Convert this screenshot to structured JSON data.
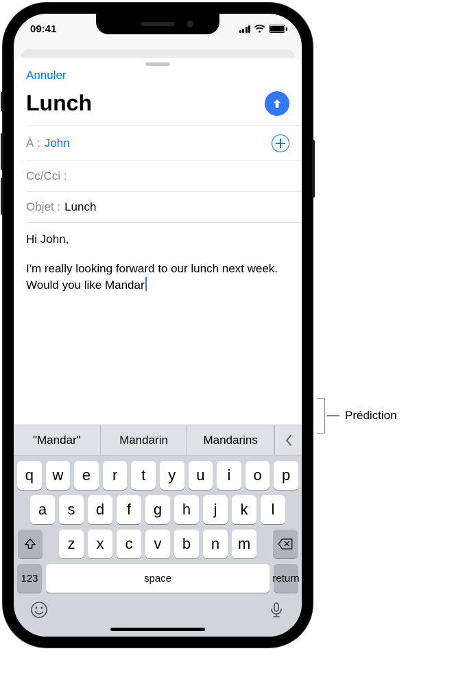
{
  "statusbar": {
    "time": "09:41"
  },
  "compose": {
    "cancel": "Annuler",
    "title": "Lunch",
    "to_label": "À :",
    "to_value": "John",
    "cc_label": "Cc/Cci :",
    "subject_label": "Objet :",
    "subject_value": "Lunch",
    "body_line1": "Hi John,",
    "body_line2": "I'm really looking forward to our lunch next week. Would you like Mandar"
  },
  "predictions": {
    "p0": "\"Mandar\"",
    "p1": "Mandarin",
    "p2": "Mandarins"
  },
  "keyboard": {
    "row1": {
      "k0": "q",
      "k1": "w",
      "k2": "e",
      "k3": "r",
      "k4": "t",
      "k5": "y",
      "k6": "u",
      "k7": "i",
      "k8": "o",
      "k9": "p"
    },
    "row2": {
      "k0": "a",
      "k1": "s",
      "k2": "d",
      "k3": "f",
      "k4": "g",
      "k5": "h",
      "k6": "j",
      "k7": "k",
      "k8": "l"
    },
    "row3": {
      "k0": "z",
      "k1": "x",
      "k2": "c",
      "k3": "v",
      "k4": "b",
      "k5": "n",
      "k6": "m"
    },
    "numKey": "123",
    "spaceKey": "space",
    "returnKey": "return"
  },
  "callout": {
    "label": "Prédiction"
  }
}
